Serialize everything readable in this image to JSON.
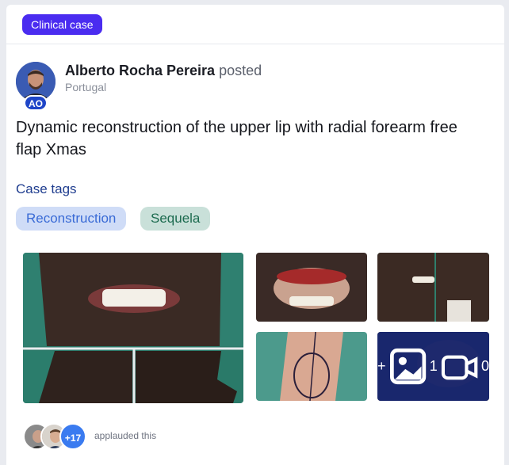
{
  "post": {
    "type_badge": "Clinical case",
    "author_name": "Alberto Rocha Pereira",
    "author_action": "posted",
    "author_country": "Portugal",
    "author_badge": "AO",
    "title": "Dynamic reconstruction of the upper lip with radial forearm free flap Xmas",
    "tags_label": "Case tags",
    "tags": [
      "Reconstruction",
      "Sequela"
    ],
    "more_overlay": {
      "images_prefix": "+",
      "images_count": "1",
      "videos_count": "0"
    },
    "applause": {
      "extra_count": "+17",
      "text": "applauded this"
    }
  },
  "colors": {
    "brand": "#4a2cf0",
    "link": "#1f3d8f",
    "tag_blue_bg": "#cfdcf7",
    "tag_green_bg": "#c9e0d9"
  }
}
